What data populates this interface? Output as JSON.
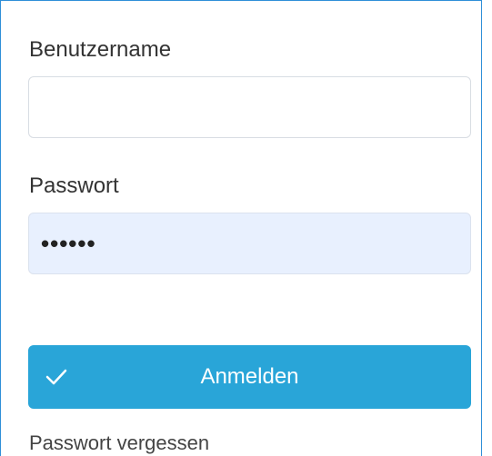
{
  "form": {
    "username_label": "Benutzername",
    "username_value": "",
    "password_label": "Passwort",
    "password_value": "••••••",
    "login_button_label": "Anmelden",
    "login_button_icon": "check-icon",
    "forgot_password_label": "Passwort vergessen"
  },
  "colors": {
    "accent": "#29a5d8",
    "panel_border": "#2f8fd8",
    "autofill_background": "#e8f0fe"
  }
}
